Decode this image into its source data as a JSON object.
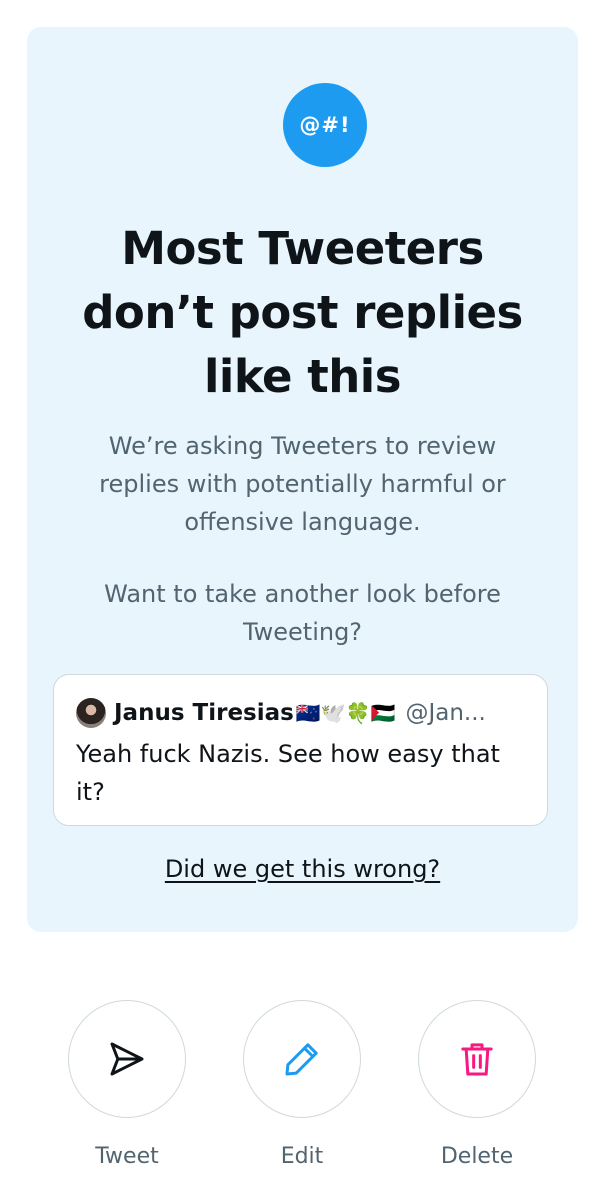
{
  "card": {
    "symbol": "@#!",
    "title": "Most Tweeters don’t post replies like this",
    "description": "We’re asking Tweeters to review replies with potentially harmful or offensive language.",
    "question": "Want to take another look before Tweeting?",
    "quoted_reply": {
      "author_name": "Janus Tiresias",
      "author_emojis": "🇳🇿🕊️🍀🇵🇸",
      "handle": "@Jan...",
      "text": "Yeah fuck Nazis. See how easy that it?"
    },
    "feedback_link": "Did we get this wrong?"
  },
  "actions": {
    "tweet": {
      "label": "Tweet",
      "icon": "send-icon"
    },
    "edit": {
      "label": "Edit",
      "icon": "pencil-icon"
    },
    "delete": {
      "label": "Delete",
      "icon": "trash-icon"
    }
  },
  "colors": {
    "card_background": "#e8f5fd",
    "accent": "#1d9bf0",
    "delete": "#f91880",
    "text_primary": "#0f1419",
    "text_secondary": "#536471"
  }
}
